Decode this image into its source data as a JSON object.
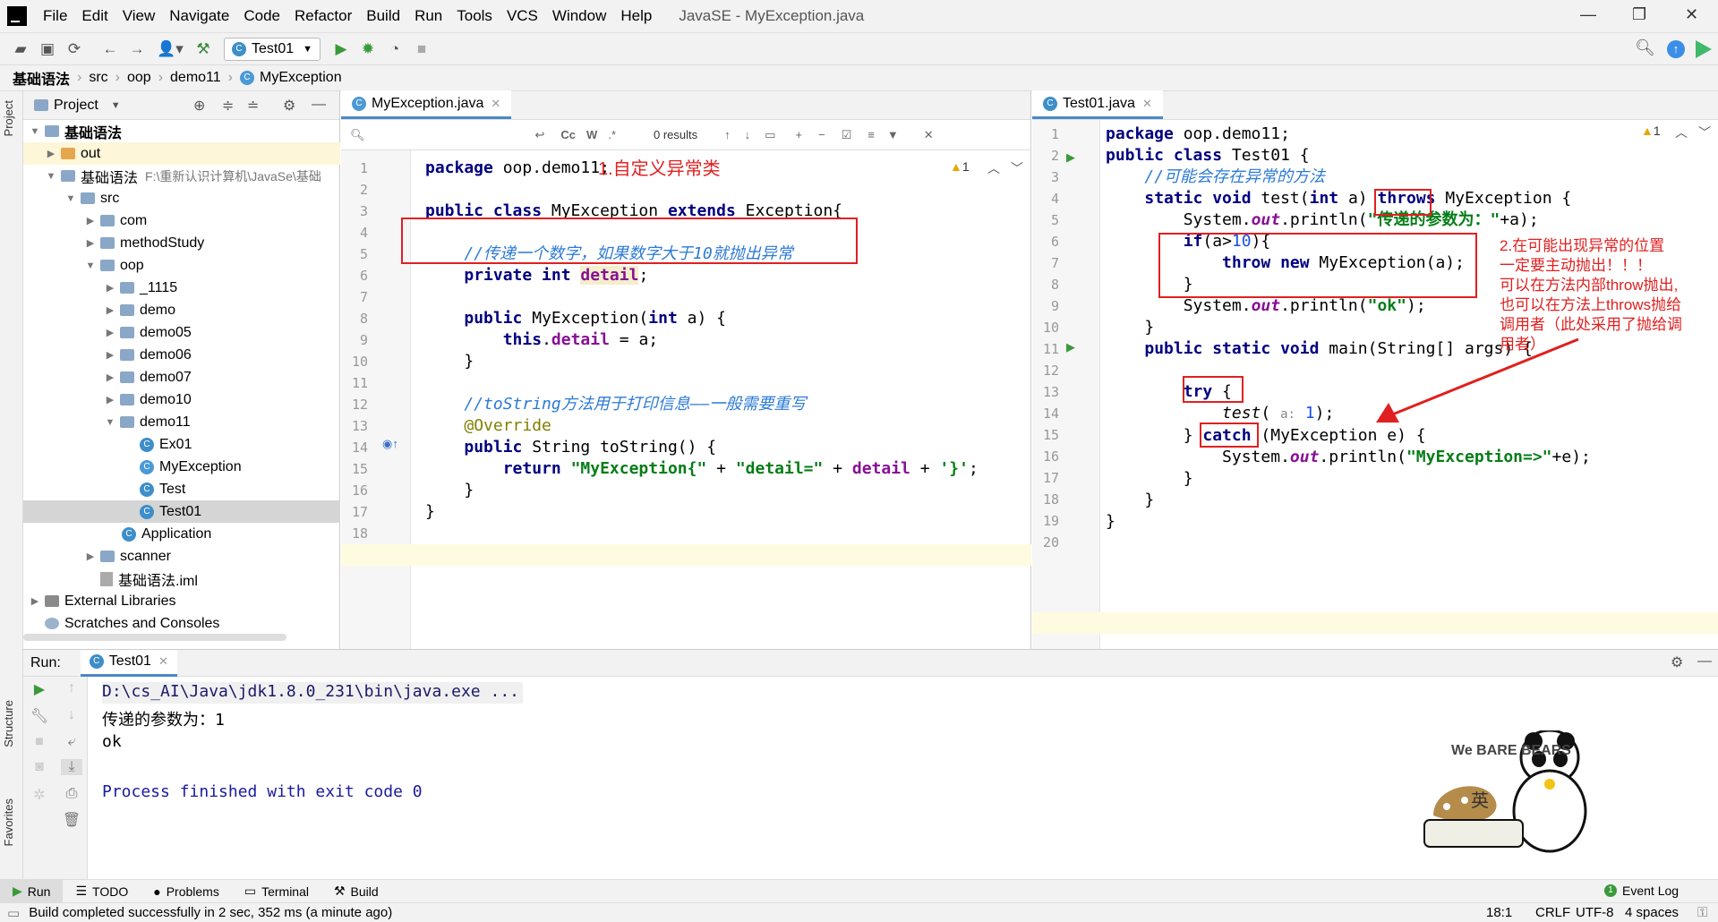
{
  "menubar": {
    "items": [
      "File",
      "Edit",
      "View",
      "Navigate",
      "Code",
      "Refactor",
      "Build",
      "Run",
      "Tools",
      "VCS",
      "Window",
      "Help"
    ],
    "window_title": "JavaSE - MyException.java"
  },
  "toolbar": {
    "run_config": "Test01"
  },
  "breadcrumbs": [
    "基础语法",
    "src",
    "oop",
    "demo11",
    "MyException"
  ],
  "project": {
    "title": "Project",
    "tree": [
      {
        "label": "基础语法"
      },
      {
        "label": "out"
      },
      {
        "label": "基础语法",
        "path": "F:\\重新认识计算机\\JavaSe\\基础"
      },
      {
        "label": "src"
      },
      {
        "label": "com"
      },
      {
        "label": "methodStudy"
      },
      {
        "label": "oop"
      },
      {
        "label": "_1115"
      },
      {
        "label": "demo"
      },
      {
        "label": "demo05"
      },
      {
        "label": "demo06"
      },
      {
        "label": "demo07"
      },
      {
        "label": "demo10"
      },
      {
        "label": "demo11"
      },
      {
        "label": "Ex01"
      },
      {
        "label": "MyException"
      },
      {
        "label": "Test"
      },
      {
        "label": "Test01"
      },
      {
        "label": "Application"
      },
      {
        "label": "scanner"
      },
      {
        "label": "基础语法.iml"
      },
      {
        "label": "External Libraries"
      },
      {
        "label": "Scratches and Consoles"
      }
    ]
  },
  "editor1": {
    "tab": "MyException.java",
    "search_results": "0 results",
    "warnings": "1",
    "annotation": "1.自定义异常类",
    "line_numbers": [
      "1",
      "2",
      "3",
      "4",
      "5",
      "6",
      "7",
      "8",
      "9",
      "10",
      "11",
      "12",
      "13",
      "14",
      "15",
      "16",
      "17",
      "18"
    ]
  },
  "editor2": {
    "tab": "Test01.java",
    "warnings": "1",
    "annotation": "2.在可能出现异常的位置\n一定要主动抛出！！！\n可以在方法内部throw抛出,\n也可以在方法上throws抛给\n调用者（此处采用了抛给调\n用者）",
    "line_numbers": [
      "1",
      "2",
      "3",
      "4",
      "5",
      "6",
      "7",
      "8",
      "9",
      "10",
      "11",
      "12",
      "13",
      "14",
      "15",
      "16",
      "17",
      "18",
      "19",
      "20"
    ]
  },
  "run": {
    "label": "Run:",
    "tab": "Test01",
    "console": [
      "D:\\cs_AI\\Java\\jdk1.8.0_231\\bin\\java.exe ...",
      "传递的参数为：1",
      "ok",
      "",
      "Process finished with exit code 0"
    ]
  },
  "side_tabs": {
    "project": "Project",
    "structure": "Structure",
    "favorites": "Favorites"
  },
  "bottom_tabs": [
    "Run",
    "TODO",
    "Problems",
    "Terminal",
    "Build"
  ],
  "event_log": "Event Log",
  "status": {
    "message": "Build completed successfully in 2 sec, 352 ms (a minute ago)",
    "position": "18:1",
    "line_sep": "CRLF",
    "encoding": "UTF-8",
    "indent": "4 spaces"
  },
  "sticker": {
    "brand": "We BARE BEARS",
    "label": "英"
  }
}
